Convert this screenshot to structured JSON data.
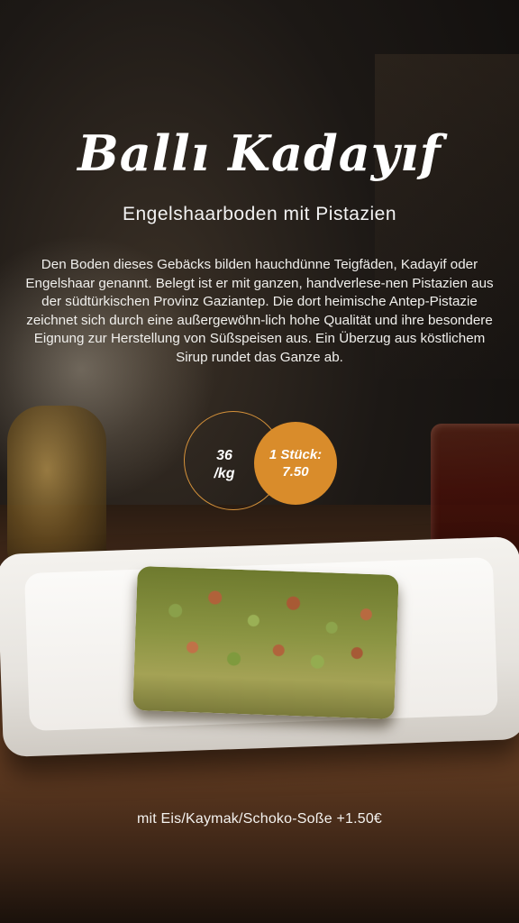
{
  "product": {
    "title": "Ballı Kadayıf",
    "subtitle": "Engelshaarboden mit Pistazien",
    "description": "Den Boden dieses Gebäcks bilden hauchdünne Teigfäden, Kadayif oder Engelshaar genannt. Belegt ist er mit ganzen, handverlese-nen Pistazien aus der südtürkischen Provinz Gaziantep. Die dort heimische Antep-Pistazie zeichnet sich durch eine außergewöhn-lich hohe Qualität und ihre besondere Eignung zur Herstellung von Süßspeisen aus. Ein Überzug aus köstlichem Sirup rundet das Ganze ab."
  },
  "prices": {
    "per_kg_value": "36",
    "per_kg_unit": "/kg",
    "per_piece_label": "1 Stück:",
    "per_piece_value": "7.50"
  },
  "extras": "mit Eis/Kaymak/Schoko-Soße +1.50€",
  "colors": {
    "accent": "#d98c2b",
    "text": "#ffffff"
  }
}
